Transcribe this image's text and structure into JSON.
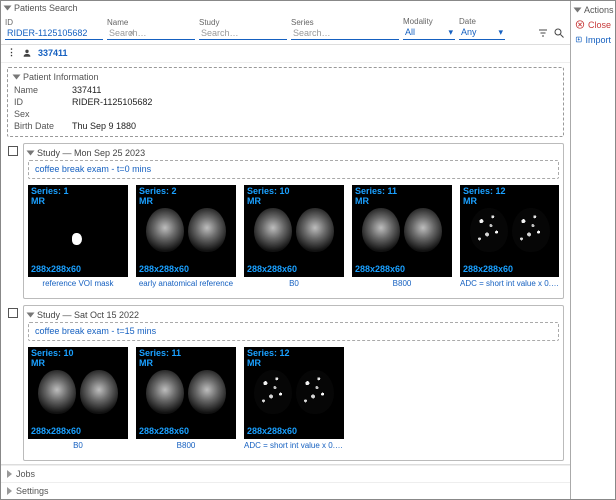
{
  "actions": {
    "title": "Actions",
    "close": "Close",
    "import": "Import"
  },
  "search": {
    "title": "Patients Search",
    "fields": {
      "id": {
        "label": "ID",
        "value": "RIDER-1125105682",
        "placeholder": ""
      },
      "name": {
        "label": "Name",
        "value": "",
        "placeholder": "Search…"
      },
      "study": {
        "label": "Study",
        "value": "",
        "placeholder": "Search…"
      },
      "series": {
        "label": "Series",
        "value": "",
        "placeholder": "Search…"
      },
      "modality": {
        "label": "Modality",
        "value": "All"
      },
      "date": {
        "label": "Date",
        "value": "Any"
      }
    }
  },
  "breadcrumb": {
    "current": "337411"
  },
  "patient": {
    "panel_title": "Patient Information",
    "name": "337411",
    "id": "RIDER-1125105682",
    "sex": "",
    "birth_date": "Thu Sep 9 1880",
    "labels": {
      "name": "Name",
      "id": "ID",
      "sex": "Sex",
      "birth_date": "Birth Date"
    }
  },
  "studies": [
    {
      "title": "Study — Mon Sep 25 2023",
      "description": "coffee break exam - t=0 mins",
      "series": [
        {
          "series_label": "Series: 1",
          "modality": "MR",
          "dims": "288x288x60",
          "caption": "reference VOI mask",
          "style": "mask"
        },
        {
          "series_label": "Series: 2",
          "modality": "MR",
          "dims": "288x288x60",
          "caption": "early anatomical reference",
          "style": "anat"
        },
        {
          "series_label": "Series: 10",
          "modality": "MR",
          "dims": "288x288x60",
          "caption": "B0",
          "style": "anat"
        },
        {
          "series_label": "Series: 11",
          "modality": "MR",
          "dims": "288x288x60",
          "caption": "B800",
          "style": "anat"
        },
        {
          "series_label": "Series: 12",
          "modality": "MR",
          "dims": "288x288x60",
          "caption": "ADC = short int value x 0.2E-…",
          "style": "speck"
        }
      ]
    },
    {
      "title": "Study — Sat Oct 15 2022",
      "description": "coffee break exam - t=15 mins",
      "series": [
        {
          "series_label": "Series: 10",
          "modality": "MR",
          "dims": "288x288x60",
          "caption": "B0",
          "style": "anat"
        },
        {
          "series_label": "Series: 11",
          "modality": "MR",
          "dims": "288x288x60",
          "caption": "B800",
          "style": "anat"
        },
        {
          "series_label": "Series: 12",
          "modality": "MR",
          "dims": "288x288x60",
          "caption": "ADC = short int value x 0.2E-…",
          "style": "speck"
        }
      ]
    }
  ],
  "bottom": {
    "jobs": "Jobs",
    "settings": "Settings"
  }
}
